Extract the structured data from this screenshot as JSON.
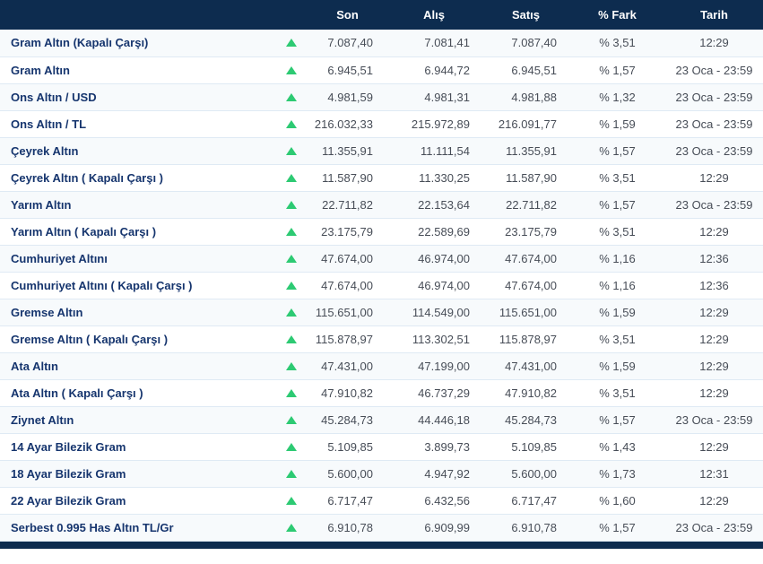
{
  "colors": {
    "header_bg": "#0d2c4f",
    "row_alt_bg": "#f7fafc",
    "row_bg": "#ffffff",
    "name_color": "#16356e",
    "value_color": "#474d57",
    "arrow_green": "#2dca73",
    "row_border": "#dfeaf4"
  },
  "table": {
    "headers": {
      "name": "",
      "trend": "",
      "son": "Son",
      "alis": "Alış",
      "satis": "Satış",
      "fark": "% Fark",
      "tarih": "Tarih"
    },
    "rows": [
      {
        "name": "Gram Altın (Kapalı Çarşı)",
        "trend": "up",
        "son": "7.087,40",
        "alis": "7.081,41",
        "satis": "7.087,40",
        "fark": "% 3,51",
        "tarih": "12:29"
      },
      {
        "name": "Gram Altın",
        "trend": "up",
        "son": "6.945,51",
        "alis": "6.944,72",
        "satis": "6.945,51",
        "fark": "% 1,57",
        "tarih": "23 Oca - 23:59"
      },
      {
        "name": "Ons Altın / USD",
        "trend": "up",
        "son": "4.981,59",
        "alis": "4.981,31",
        "satis": "4.981,88",
        "fark": "% 1,32",
        "tarih": "23 Oca - 23:59"
      },
      {
        "name": "Ons Altın / TL",
        "trend": "up",
        "son": "216.032,33",
        "alis": "215.972,89",
        "satis": "216.091,77",
        "fark": "% 1,59",
        "tarih": "23 Oca - 23:59"
      },
      {
        "name": "Çeyrek Altın",
        "trend": "up",
        "son": "11.355,91",
        "alis": "11.111,54",
        "satis": "11.355,91",
        "fark": "% 1,57",
        "tarih": "23 Oca - 23:59"
      },
      {
        "name": "Çeyrek Altın ( Kapalı Çarşı )",
        "trend": "up",
        "son": "11.587,90",
        "alis": "11.330,25",
        "satis": "11.587,90",
        "fark": "% 3,51",
        "tarih": "12:29"
      },
      {
        "name": "Yarım Altın",
        "trend": "up",
        "son": "22.711,82",
        "alis": "22.153,64",
        "satis": "22.711,82",
        "fark": "% 1,57",
        "tarih": "23 Oca - 23:59"
      },
      {
        "name": "Yarım Altın ( Kapalı Çarşı )",
        "trend": "up",
        "son": "23.175,79",
        "alis": "22.589,69",
        "satis": "23.175,79",
        "fark": "% 3,51",
        "tarih": "12:29"
      },
      {
        "name": "Cumhuriyet Altını",
        "trend": "up",
        "son": "47.674,00",
        "alis": "46.974,00",
        "satis": "47.674,00",
        "fark": "% 1,16",
        "tarih": "12:36"
      },
      {
        "name": "Cumhuriyet Altını ( Kapalı Çarşı )",
        "trend": "up",
        "son": "47.674,00",
        "alis": "46.974,00",
        "satis": "47.674,00",
        "fark": "% 1,16",
        "tarih": "12:36"
      },
      {
        "name": "Gremse Altın",
        "trend": "up",
        "son": "115.651,00",
        "alis": "114.549,00",
        "satis": "115.651,00",
        "fark": "% 1,59",
        "tarih": "12:29"
      },
      {
        "name": "Gremse Altın ( Kapalı Çarşı )",
        "trend": "up",
        "son": "115.878,97",
        "alis": "113.302,51",
        "satis": "115.878,97",
        "fark": "% 3,51",
        "tarih": "12:29"
      },
      {
        "name": "Ata Altın",
        "trend": "up",
        "son": "47.431,00",
        "alis": "47.199,00",
        "satis": "47.431,00",
        "fark": "% 1,59",
        "tarih": "12:29"
      },
      {
        "name": "Ata Altın ( Kapalı Çarşı )",
        "trend": "up",
        "son": "47.910,82",
        "alis": "46.737,29",
        "satis": "47.910,82",
        "fark": "% 3,51",
        "tarih": "12:29"
      },
      {
        "name": "Ziynet Altın",
        "trend": "up",
        "son": "45.284,73",
        "alis": "44.446,18",
        "satis": "45.284,73",
        "fark": "% 1,57",
        "tarih": "23 Oca - 23:59"
      },
      {
        "name": "14 Ayar Bilezik Gram",
        "trend": "up",
        "son": "5.109,85",
        "alis": "3.899,73",
        "satis": "5.109,85",
        "fark": "% 1,43",
        "tarih": "12:29"
      },
      {
        "name": "18 Ayar Bilezik Gram",
        "trend": "up",
        "son": "5.600,00",
        "alis": "4.947,92",
        "satis": "5.600,00",
        "fark": "% 1,73",
        "tarih": "12:31"
      },
      {
        "name": "22 Ayar Bilezik Gram",
        "trend": "up",
        "son": "6.717,47",
        "alis": "6.432,56",
        "satis": "6.717,47",
        "fark": "% 1,60",
        "tarih": "12:29"
      },
      {
        "name": "Serbest 0.995 Has Altın TL/Gr",
        "trend": "up",
        "son": "6.910,78",
        "alis": "6.909,99",
        "satis": "6.910,78",
        "fark": "% 1,57",
        "tarih": "23 Oca - 23:59"
      }
    ]
  }
}
